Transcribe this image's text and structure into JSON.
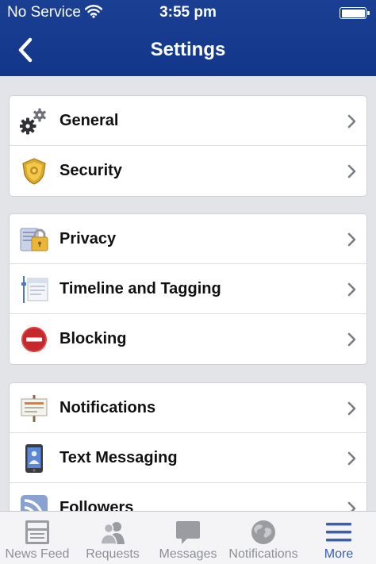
{
  "status_bar": {
    "carrier": "No Service",
    "time": "3:55 pm"
  },
  "nav": {
    "title": "Settings"
  },
  "groups": [
    {
      "items": [
        {
          "label": "General",
          "icon": "gears-icon"
        },
        {
          "label": "Security",
          "icon": "security-badge-icon"
        }
      ]
    },
    {
      "items": [
        {
          "label": "Privacy",
          "icon": "privacy-lock-icon"
        },
        {
          "label": "Timeline and Tagging",
          "icon": "timeline-icon"
        },
        {
          "label": "Blocking",
          "icon": "blocking-icon"
        }
      ]
    },
    {
      "items": [
        {
          "label": "Notifications",
          "icon": "notifications-sign-icon"
        },
        {
          "label": "Text Messaging",
          "icon": "phone-icon"
        },
        {
          "label": "Followers",
          "icon": "rss-icon"
        }
      ]
    }
  ],
  "tabbar": {
    "tabs": [
      {
        "label": "News Feed",
        "icon": "news-feed-icon"
      },
      {
        "label": "Requests",
        "icon": "friends-icon"
      },
      {
        "label": "Messages",
        "icon": "chat-bubble-icon"
      },
      {
        "label": "Notifications",
        "icon": "globe-icon"
      },
      {
        "label": "More",
        "icon": "hamburger-menu-icon"
      }
    ],
    "active": "More"
  },
  "colors": {
    "header": "#153a8f",
    "background": "#e3e4e8",
    "active_tab": "#3b5fb0",
    "inactive_tab": "#8e9096"
  }
}
